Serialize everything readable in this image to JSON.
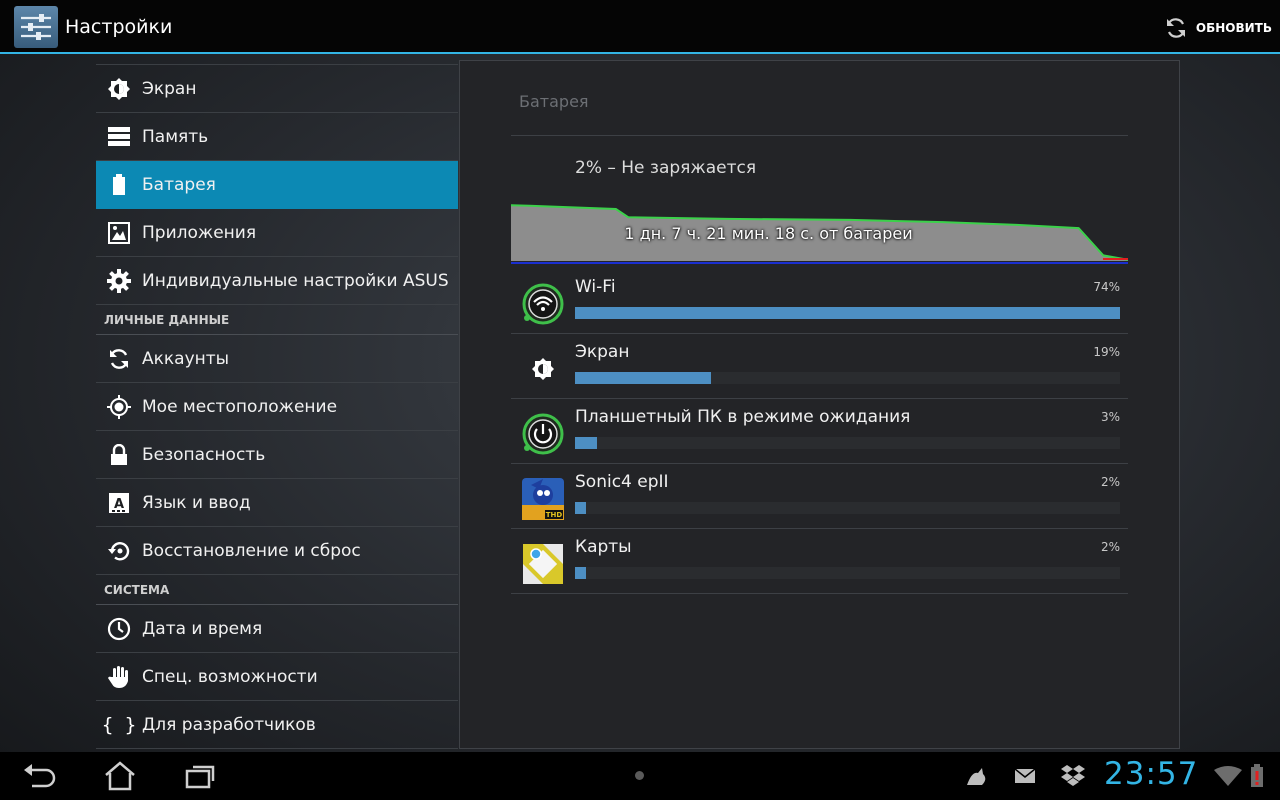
{
  "actionbar": {
    "title": "Настройки",
    "refresh_label": "ОБНОВИТЬ",
    "icons": [
      "settings-app-icon",
      "refresh-icon"
    ]
  },
  "sidebar": {
    "items": [
      {
        "label": "Экран",
        "icon": "brightness-icon"
      },
      {
        "label": "Память",
        "icon": "storage-icon"
      },
      {
        "label": "Батарея",
        "icon": "battery-icon",
        "selected": true
      },
      {
        "label": "Приложения",
        "icon": "apps-icon"
      },
      {
        "label": "Индивидуальные настройки ASUS",
        "icon": "gear-icon"
      }
    ],
    "section_personal": "ЛИЧНЫЕ ДАННЫЕ",
    "personal_items": [
      {
        "label": "Аккаунты",
        "icon": "sync-icon"
      },
      {
        "label": "Мое местоположение",
        "icon": "location-icon"
      },
      {
        "label": "Безопасность",
        "icon": "lock-icon"
      },
      {
        "label": "Язык и ввод",
        "icon": "keyboard-icon"
      },
      {
        "label": "Восстановление и сброс",
        "icon": "restore-icon"
      }
    ],
    "section_system": "СИСТЕМА",
    "system_items": [
      {
        "label": "Дата и время",
        "icon": "clock-icon"
      },
      {
        "label": "Спец. возможности",
        "icon": "hand-icon"
      },
      {
        "label": "Для разработчиков",
        "icon": "braces-icon"
      }
    ]
  },
  "battery": {
    "title": "Батарея",
    "status": "2% – Не заряжается",
    "graph_label": "1 дн. 7 ч. 21 мин. 18 с. от батареи",
    "graph_level_start": 0.93,
    "graph_level_end": 0.02,
    "usage": [
      {
        "name": "Wi-Fi",
        "percent": "74%",
        "fraction": 1.0,
        "icon": "wifi-icon"
      },
      {
        "name": "Экран",
        "percent": "19%",
        "fraction": 0.25,
        "icon": "brightness-icon"
      },
      {
        "name": "Планшетный ПК в режиме ожидания",
        "percent": "3%",
        "fraction": 0.04,
        "icon": "power-icon"
      },
      {
        "name": "Sonic4 epII",
        "percent": "2%",
        "fraction": 0.02,
        "icon": "sonic-app-icon"
      },
      {
        "name": "Карты",
        "percent": "2%",
        "fraction": 0.02,
        "icon": "maps-app-icon"
      }
    ],
    "colors": {
      "accent": "#33b5e5",
      "selected": "#0c89b4",
      "bar": "#4d8fc3",
      "graph_line": "#3bd14a"
    }
  },
  "systembar": {
    "clock": "23:57",
    "nav_icons": [
      "back-icon",
      "home-icon",
      "recent-apps-icon"
    ],
    "status_icons": [
      "bird-notification-icon",
      "mail-icon",
      "dropbox-icon",
      "wifi-icon",
      "battery-alert-icon"
    ]
  }
}
